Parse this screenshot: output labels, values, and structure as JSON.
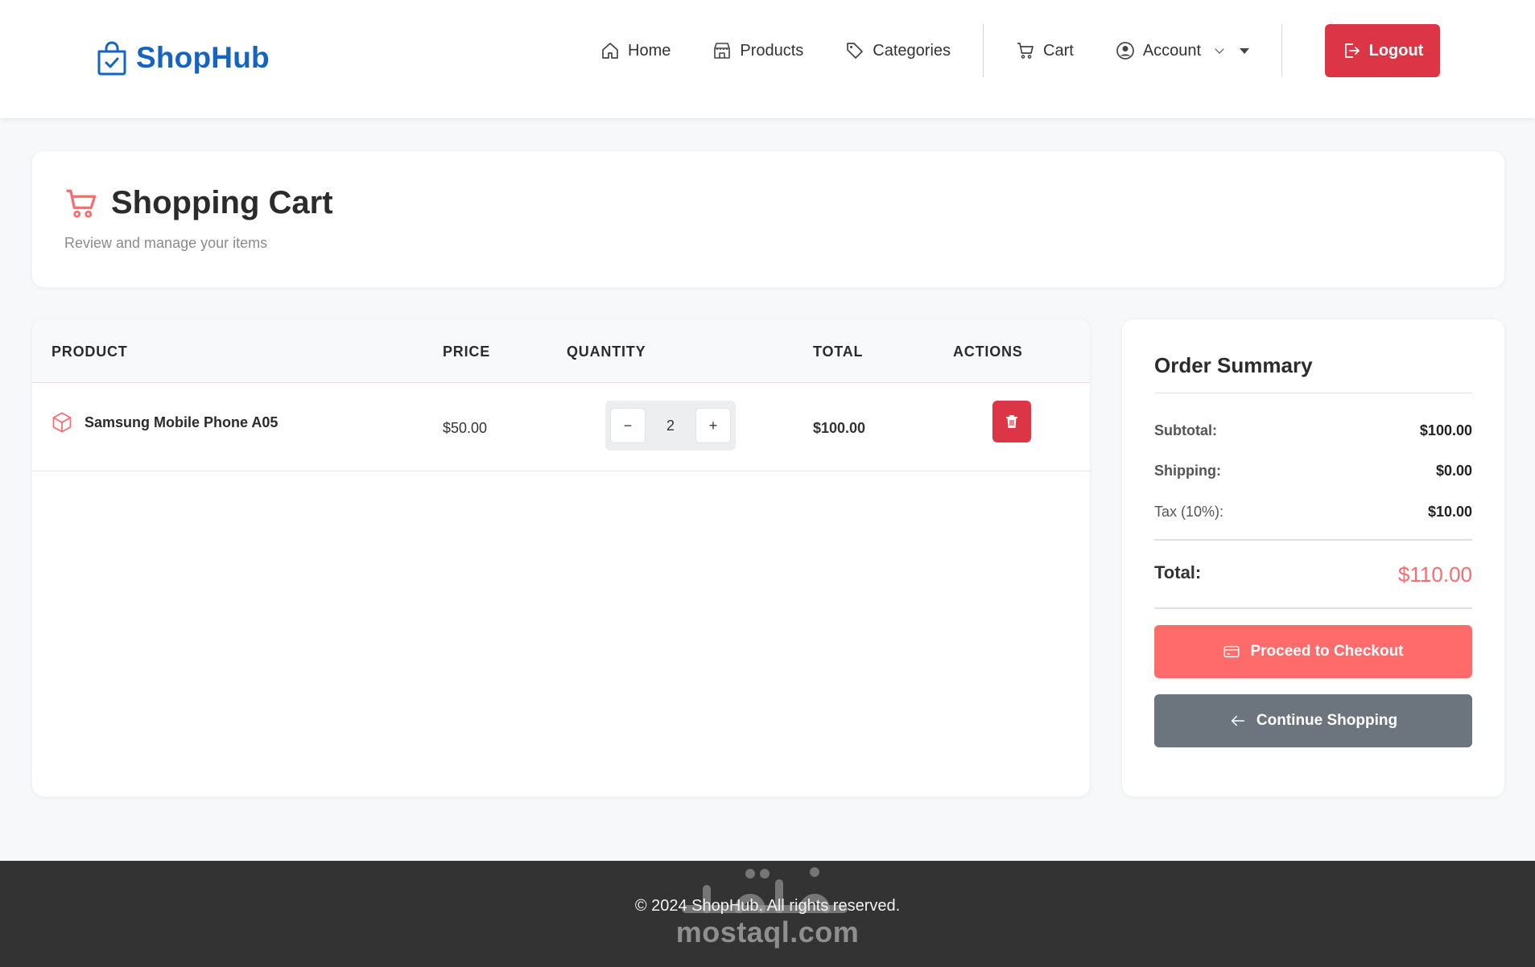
{
  "brand": {
    "name": "ShopHub",
    "color": "#1565c0"
  },
  "nav": {
    "items": [
      {
        "label": "Home",
        "icon": "house-icon"
      },
      {
        "label": "Products",
        "icon": "store-icon"
      },
      {
        "label": "Categories",
        "icon": "tag-icon"
      },
      {
        "label": "Cart",
        "icon": "cart-icon"
      },
      {
        "label": "Account",
        "icon": "user-circle-icon"
      }
    ],
    "logout_label": "Logout"
  },
  "header": {
    "title": "Shopping Cart",
    "subtitle": "Review and manage your items"
  },
  "cart": {
    "columns": [
      "PRODUCT",
      "PRICE",
      "QUANTITY",
      "TOTAL",
      "ACTIONS"
    ],
    "rows": [
      {
        "product": "Samsung Mobile Phone A05",
        "price": "$50.00",
        "quantity": "2",
        "total": "$100.00"
      }
    ]
  },
  "summary": {
    "title": "Order Summary",
    "subtotal_label": "Subtotal:",
    "subtotal_value": "$100.00",
    "shipping_label": "Shipping:",
    "shipping_value": "$0.00",
    "tax_label": "Tax (10%):",
    "tax_value": "$10.00",
    "total_label": "Total:",
    "total_value": "$110.00",
    "checkout_label": "Proceed to Checkout",
    "continue_label": "Continue Shopping"
  },
  "footer": {
    "copyright": "© 2024 ShopHub. All rights reserved.",
    "watermark_domain": "mostaql.com"
  },
  "colors": {
    "accent": "#ff6b6b",
    "danger": "#dc3545",
    "secondary": "#6c757d",
    "footer_bg": "#333333"
  }
}
